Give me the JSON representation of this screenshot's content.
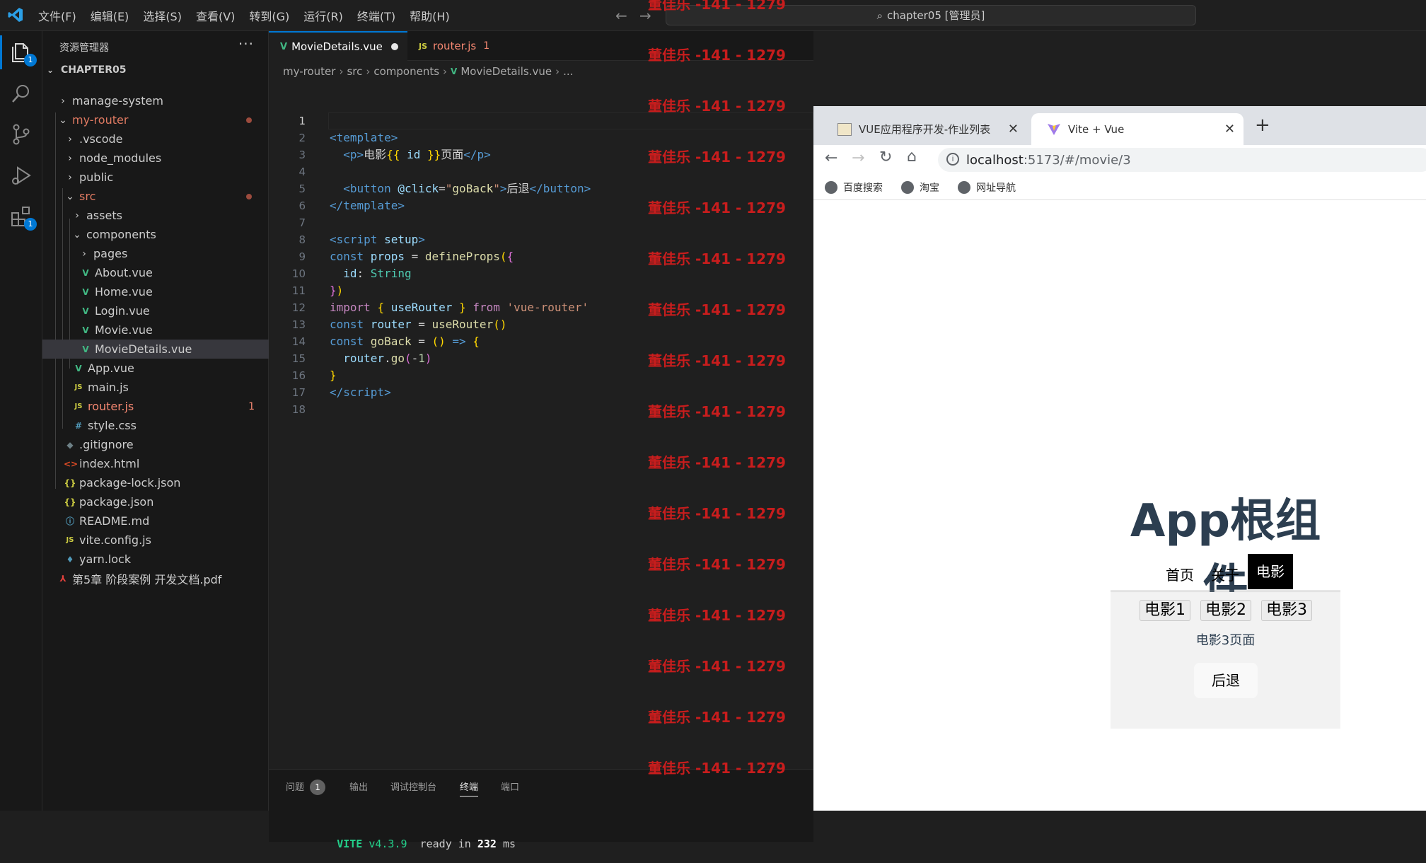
{
  "menubar": {
    "items": [
      "文件(F)",
      "编辑(E)",
      "选择(S)",
      "查看(V)",
      "转到(G)",
      "运行(R)",
      "终端(T)",
      "帮助(H)"
    ]
  },
  "command_center": {
    "text": "chapter05 [管理员]"
  },
  "activity": {
    "explorer_badge": "1",
    "extensions_badge": "1"
  },
  "sidebar": {
    "title": "资源管理器",
    "section": "CHAPTER05",
    "items": [
      {
        "label": "manage-system",
        "color": "#cccccc"
      },
      {
        "label": "my-router",
        "color": "#e07a62"
      },
      {
        "label": ".vscode",
        "color": "#cccccc"
      },
      {
        "label": "node_modules",
        "color": "#cccccc"
      },
      {
        "label": "public",
        "color": "#cccccc"
      },
      {
        "label": "src",
        "color": "#e07a62"
      },
      {
        "label": "assets",
        "color": "#cccccc"
      },
      {
        "label": "components",
        "color": "#cccccc"
      },
      {
        "label": "pages",
        "color": "#cccccc"
      },
      {
        "label": "About.vue",
        "color": "#cccccc"
      },
      {
        "label": "Home.vue",
        "color": "#cccccc"
      },
      {
        "label": "Login.vue",
        "color": "#cccccc"
      },
      {
        "label": "Movie.vue",
        "color": "#cccccc"
      },
      {
        "label": "MovieDetails.vue",
        "color": "#cccccc"
      },
      {
        "label": "App.vue",
        "color": "#cccccc"
      },
      {
        "label": "main.js",
        "color": "#cccccc"
      },
      {
        "label": "router.js",
        "color": "#f48771",
        "count": "1"
      },
      {
        "label": "style.css",
        "color": "#cccccc"
      },
      {
        "label": ".gitignore",
        "color": "#cccccc"
      },
      {
        "label": "index.html",
        "color": "#cccccc"
      },
      {
        "label": "package-lock.json",
        "color": "#cccccc"
      },
      {
        "label": "package.json",
        "color": "#cccccc"
      },
      {
        "label": "README.md",
        "color": "#cccccc"
      },
      {
        "label": "vite.config.js",
        "color": "#cccccc"
      },
      {
        "label": "yarn.lock",
        "color": "#cccccc"
      },
      {
        "label": "第5章 阶段案例 开发文档.pdf",
        "color": "#cccccc"
      }
    ]
  },
  "editor": {
    "tabs": [
      {
        "label": "MovieDetails.vue"
      },
      {
        "label": "router.js",
        "count": "1"
      }
    ],
    "breadcrumb": [
      "my-router",
      "src",
      "components",
      "MovieDetails.vue",
      "..."
    ],
    "line_numbers": [
      "1",
      "2",
      "3",
      "4",
      "5",
      "6",
      "7",
      "8",
      "9",
      "10",
      "11",
      "12",
      "13",
      "14",
      "15",
      "16",
      "17",
      "18"
    ]
  },
  "panel": {
    "tabs": [
      "问题",
      "输出",
      "调试控制台",
      "终端",
      "端口"
    ],
    "problems_count": "1",
    "terminal": {
      "vite": "VITE",
      "version": "v4.3.9",
      "ready": "ready in",
      "ms_value": "232",
      "ms_unit": "ms"
    }
  },
  "watermark": {
    "text": "董佳乐 -141 - 1279"
  },
  "browser": {
    "tabs": [
      {
        "label": "VUE应用程序开发-作业列表"
      },
      {
        "label": "Vite + Vue"
      }
    ],
    "new_tab": "+",
    "url_host": "localhost",
    "url_path": ":5173/#/movie/3",
    "bookmarks": [
      "百度搜索",
      "淘宝",
      "网址导航"
    ]
  },
  "app": {
    "title": "App根组件",
    "nav": [
      "首页",
      "关于",
      "电影"
    ],
    "movies": [
      "电影1",
      "电影2",
      "电影3"
    ],
    "page_text": "电影3页面",
    "back_button": "后退"
  }
}
